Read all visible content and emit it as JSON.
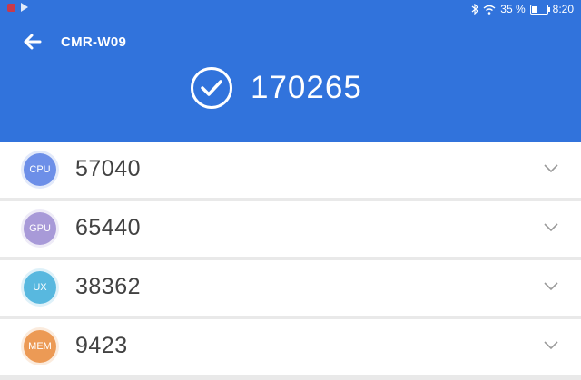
{
  "status_bar": {
    "battery_percent": "35 %",
    "battery_level": 0.35,
    "time": "8:20",
    "icons": [
      "notification-icon",
      "play-store-icon",
      "bluetooth-icon",
      "wifi-icon",
      "battery-icon"
    ]
  },
  "header": {
    "device": "CMR-W09",
    "total_score": "170265",
    "icons": [
      "back-arrow-icon",
      "check-circle-icon"
    ],
    "background_color": "#3173dc"
  },
  "scores": [
    {
      "label": "CPU",
      "value": "57040",
      "color": "#6d8fe8"
    },
    {
      "label": "GPU",
      "value": "65440",
      "color": "#a89ad8"
    },
    {
      "label": "UX",
      "value": "38362",
      "color": "#58b8df"
    },
    {
      "label": "MEM",
      "value": "9423",
      "color": "#ec9a55"
    }
  ],
  "row_icon": "chevron-down-icon"
}
